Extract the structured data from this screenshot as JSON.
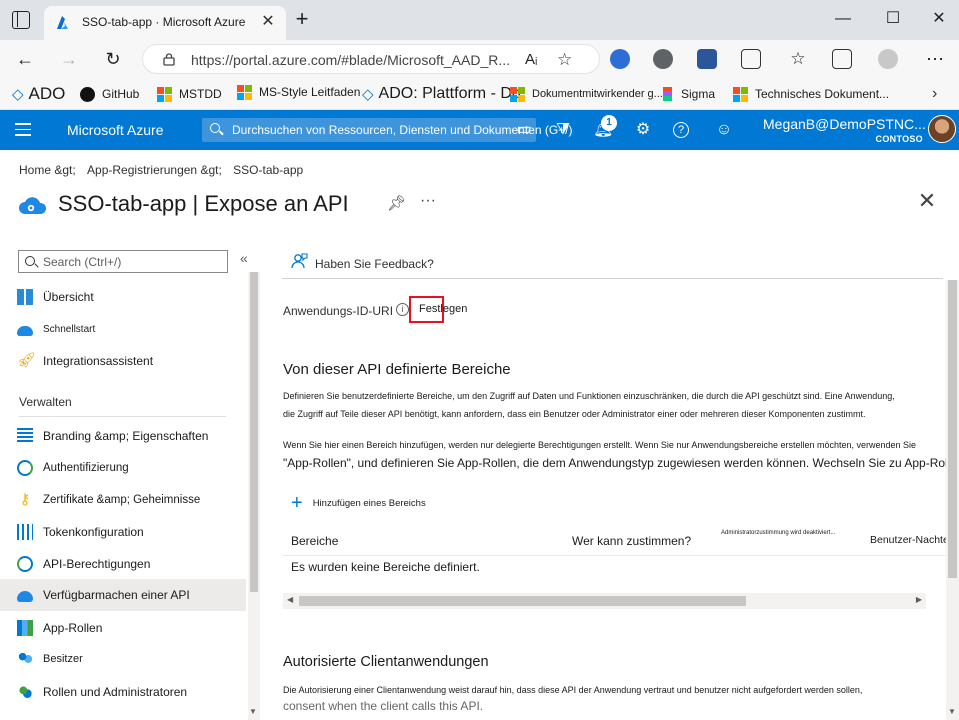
{
  "browser": {
    "tab_title": "SSO-tab-app · Microsoft Azure",
    "url": "https://portal.azure.com/#blade/Microsoft_AAD_R...",
    "read_aloud": "Aᵢ"
  },
  "favorites": [
    {
      "label": "ADO",
      "icon": "ado-icon"
    },
    {
      "label": "GitHub",
      "icon": "github-icon"
    },
    {
      "label": "MSTDD",
      "icon": "microsoft-logo-icon"
    },
    {
      "label": "MS-Style Leitfaden",
      "icon": "microsoft-logo-icon"
    },
    {
      "label": "ADO: Plattform - Do",
      "icon": "ado-icon"
    },
    {
      "label": "Dokumentmitwirkender g...",
      "icon": "microsoft-logo-icon"
    },
    {
      "label": "Sigma",
      "icon": "figma-icon"
    },
    {
      "label": "Technisches Dokument...",
      "icon": "microsoft-logo-icon"
    }
  ],
  "azure_header": {
    "brand": "Microsoft Azure",
    "search_placeholder": "Durchsuchen von Ressourcen, Diensten und Dokumenten (G+/)",
    "notifications_count": "1",
    "account_name": "MeganB@DemoPSTNC...",
    "tenant": "CONTOSO"
  },
  "breadcrumb": [
    "Home &gt;",
    "App-Registrierungen &gt;",
    "SSO-tab-app"
  ],
  "page_title": "SSO-tab-app | Expose an API",
  "sidebar": {
    "search_placeholder": "Search (Ctrl+/)",
    "collapse": "«",
    "top_items": [
      "Übersicht",
      "Schnellstart",
      "Integrationsassistent"
    ],
    "section_label": "Verwalten",
    "manage_items": [
      "Branding &amp; Eigenschaften",
      "Authentifizierung",
      "Zertifikate &amp; Geheimnisse",
      "Tokenkonfiguration",
      "API-Berechtigungen",
      "Verfügbarmachen einer API",
      "App-Rollen",
      "Besitzer",
      "Rollen und Administratoren"
    ],
    "active_item": "Verfügbarmachen einer API"
  },
  "main": {
    "feedback": "Haben Sie Feedback?",
    "app_id_uri_label": "Anwendungs-ID-URI",
    "info": "i",
    "set_button": "Festlegen",
    "scopes_heading": "Von dieser API definierte Bereiche",
    "scopes_desc_1": "Definieren Sie benutzerdefinierte Bereiche, um den Zugriff auf Daten und Funktionen einzuschränken, die durch die API geschützt sind. Eine Anwendung,",
    "scopes_desc_2": "die Zugriff auf Teile dieser API benötigt, kann anfordern, dass ein Benutzer oder Administrator einer oder mehreren dieser Komponenten zustimmt.",
    "scopes_desc_3": "Wenn Sie hier einen Bereich hinzufügen, werden nur delegierte Berechtigungen erstellt. Wenn Sie nur Anwendungsbereiche erstellen möchten, verwenden Sie",
    "scopes_desc_4": "\"App-Rollen\", und definieren Sie App-Rollen, die dem Anwendungstyp zugewiesen werden können. Wechseln Sie zu App-Rollen.",
    "add_scope": "Hinzufügen eines Bereichs",
    "table_headers": [
      "Bereiche",
      "Wer kann zustimmen?",
      "Administratorzustimmung wird deaktiviert...",
      "Benutzer-Nachteile"
    ],
    "table_empty": "Es wurden keine Bereiche definiert.",
    "clients_heading": "Autorisierte Clientanwendungen",
    "clients_desc_1": "Die Autorisierung einer Clientanwendung weist darauf hin, dass diese API der Anwendung vertraut und benutzer nicht aufgefordert werden sollen,",
    "clients_desc_2": "consent when the client calls this API."
  },
  "colors": {
    "azure_blue": "#0078d4",
    "highlight_red": "#e81123",
    "active_bg": "#edebe9"
  }
}
